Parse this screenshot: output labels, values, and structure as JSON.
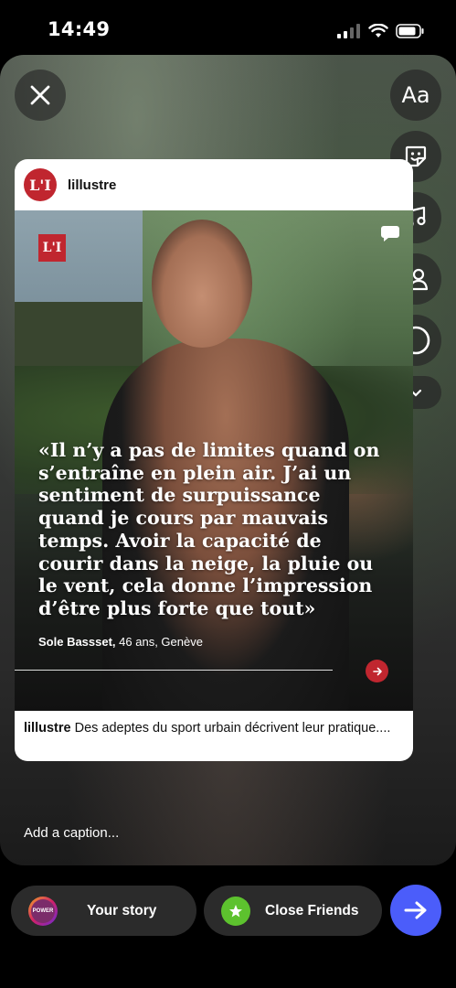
{
  "status_bar": {
    "time": "14:49"
  },
  "tools": {
    "text_tool_label": "Aa"
  },
  "post": {
    "username": "lillustre",
    "logo_text": "L'I",
    "quote": "«Il n’y a pas de limites quand on s’entraîne en plein air. J’ai un sentiment de surpuissance quand je cours par mauvais temps. Avoir la capacité de courir dans la neige, la pluie ou le vent, cela donne l’impression d’être plus forte que tout»",
    "attribution_name": "Sole Bassset,",
    "attribution_rest": " 46 ans, Genève",
    "caption_user": "lillustre",
    "caption_text": " Des adeptes du sport urbain décrivent leur pratique...."
  },
  "caption_placeholder": "Add a caption...",
  "share": {
    "your_story_label": "Your story",
    "avatar_text": "POWER",
    "close_friends_label": "Close Friends"
  },
  "colors": {
    "brand_red": "#c0262f",
    "send_blue": "#4b5dfa",
    "close_friends_green": "#5dc22e"
  }
}
